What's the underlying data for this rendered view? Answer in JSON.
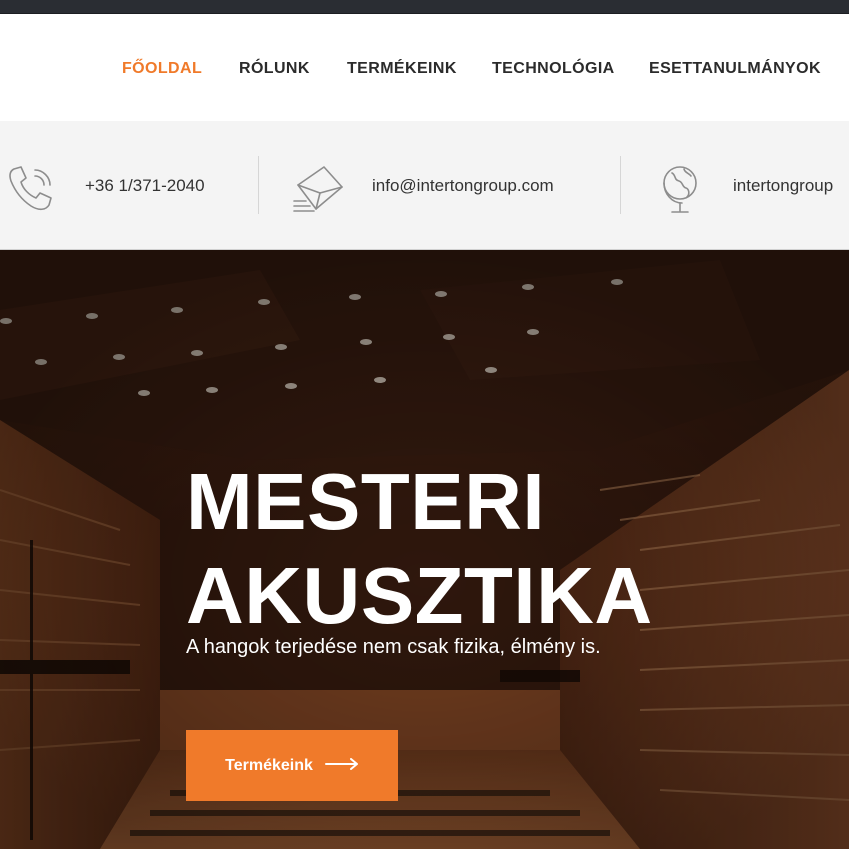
{
  "nav": {
    "items": [
      {
        "label": "FŐOLDAL",
        "active": true
      },
      {
        "label": "RÓLUNK",
        "active": false
      },
      {
        "label": "TERMÉKEINK",
        "active": false
      },
      {
        "label": "TECHNOLÓGIA",
        "active": false
      },
      {
        "label": "ESETTANULMÁNYOK",
        "active": false
      }
    ]
  },
  "contact": {
    "phone": "+36 1/371-2040",
    "email": "info@intertongroup.com",
    "website": "intertongroup",
    "icons": [
      "phone-icon",
      "envelope-icon",
      "globe-icon"
    ]
  },
  "hero": {
    "title_line1": "MESTERI",
    "title_line2": "AKUSZTIKA",
    "subtitle": "A hangok terjedése nem csak fizika, élmény is.",
    "cta_label": "Termékeink",
    "cta_icon": "arrow-right-icon"
  },
  "colors": {
    "accent": "#f07a2a",
    "nav_text": "#2b2b2b",
    "contact_bg": "#f4f4f4",
    "top_strip": "#2a2d33",
    "hero_wood": "#8a4a26"
  }
}
